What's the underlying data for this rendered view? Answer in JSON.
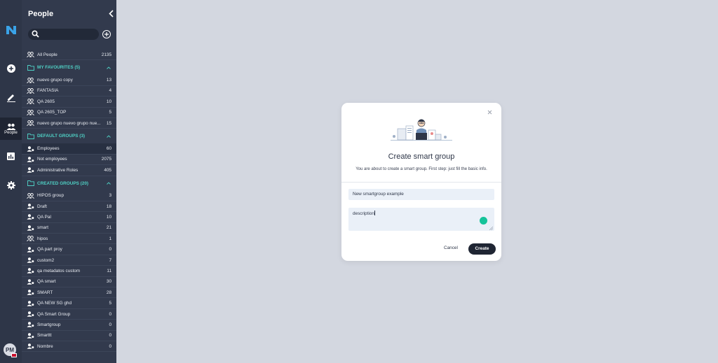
{
  "rail": {
    "people_label": "People",
    "avatar_initials": "PM",
    "icons": [
      "logo-icon",
      "add-circle-icon",
      "edit-icon",
      "people-icon",
      "stats-icon",
      "gear-icon"
    ]
  },
  "sidebar": {
    "title": "People",
    "search_placeholder": "",
    "all_people": {
      "label": "All People",
      "count": "2135"
    },
    "groups": [
      {
        "title": "MY FAVOURITES (5)",
        "items": [
          {
            "label": "nuevo grupo copy",
            "count": "13",
            "icon": "group-outline"
          },
          {
            "label": "FANTASIA",
            "count": "4",
            "icon": "group-outline"
          },
          {
            "label": "QA 2605",
            "count": "10",
            "icon": "group-outline"
          },
          {
            "label": "QA 2605_TOP",
            "count": "5",
            "icon": "group-outline"
          },
          {
            "label": "nuevo grupo nuevo grupo nue...",
            "count": "15",
            "icon": "group-outline"
          }
        ]
      },
      {
        "title": "DEFAULT GROUPS (3)",
        "items": [
          {
            "label": "Employees",
            "count": "60",
            "icon": "group-smart",
            "active": true
          },
          {
            "label": "Not employees",
            "count": "2075",
            "icon": "group-smart"
          },
          {
            "label": "Administrative Roles",
            "count": "405",
            "icon": "group-smart"
          }
        ]
      },
      {
        "title": "CREATED GROUPS (20)",
        "items": [
          {
            "label": "HIPOS group",
            "count": "3",
            "icon": "group-outline"
          },
          {
            "label": "Draft",
            "count": "18",
            "icon": "group-smart"
          },
          {
            "label": "QA Pal",
            "count": "10",
            "icon": "group-smart"
          },
          {
            "label": "smart",
            "count": "21",
            "icon": "group-smart"
          },
          {
            "label": "hipos",
            "count": "1",
            "icon": "group-outline"
          },
          {
            "label": "QA part proy",
            "count": "0",
            "icon": "group-smart"
          },
          {
            "label": "custom2",
            "count": "7",
            "icon": "group-smart"
          },
          {
            "label": "qa metadatos custom",
            "count": "11",
            "icon": "group-smart"
          },
          {
            "label": "QA smart",
            "count": "30",
            "icon": "group-smart"
          },
          {
            "label": "SMART",
            "count": "28",
            "icon": "group-smart"
          },
          {
            "label": "QA NEW SG ghd",
            "count": "5",
            "icon": "group-smart"
          },
          {
            "label": "QA Smart Group",
            "count": "0",
            "icon": "group-smart"
          },
          {
            "label": "Smartgroup",
            "count": "0",
            "icon": "group-smart"
          },
          {
            "label": "Smarttt",
            "count": "0",
            "icon": "group-smart"
          },
          {
            "label": "Nombre",
            "count": "0",
            "icon": "group-smart"
          }
        ]
      }
    ]
  },
  "modal": {
    "title": "Create smart group",
    "subtitle": "You are about to create a smart group. First step: just fill the basic info.",
    "name_value": "New smartgroup example",
    "description_value": "description",
    "cancel_label": "Cancel",
    "create_label": "Create"
  },
  "colors": {
    "rail_bg": "#2e3648",
    "sidebar_bg": "#323a4d",
    "accent_teal": "#4fd1c5",
    "page_bg": "#d3d7e0",
    "button_dark": "#1f2533"
  }
}
